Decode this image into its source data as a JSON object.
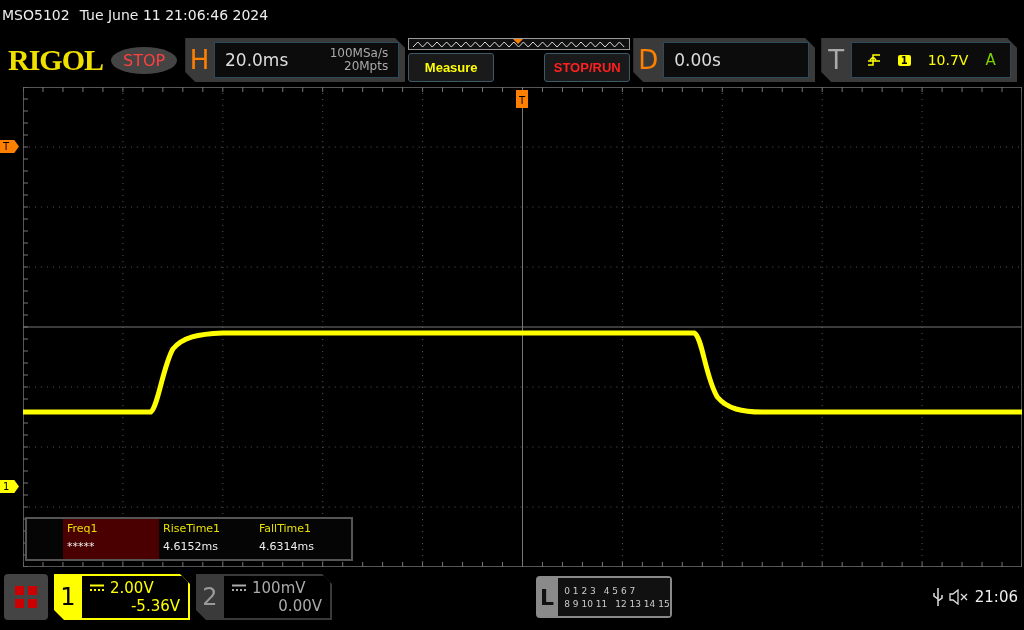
{
  "status_line": {
    "model": "MSO5102",
    "datetime": "Tue June 11 21:06:46 2024"
  },
  "toolbar": {
    "logo": "RIGOL",
    "run_state": "STOP",
    "horizontal": {
      "label": "H",
      "timebase": "20.0ms",
      "sample_rate": "100MSa/s",
      "memory_depth": "20Mpts"
    },
    "buttons": [
      {
        "label": "Measure",
        "kind": "measure"
      },
      {
        "label": "STOP/RUN",
        "kind": "run"
      }
    ],
    "delay": {
      "label": "D",
      "value": "0.00s"
    },
    "trigger": {
      "label": "T",
      "source": "1",
      "level": "10.7V",
      "mode": "A"
    }
  },
  "screen": {
    "trigger_position_marker": "T",
    "markers": [
      {
        "label": "T",
        "kind": "trigger"
      },
      {
        "label": "1",
        "kind": "channel"
      }
    ],
    "measurements": [
      {
        "name": "Freq1",
        "value": "*****",
        "selected": true
      },
      {
        "name": "RiseTime1",
        "value": "4.6152ms",
        "selected": false
      },
      {
        "name": "FallTime1",
        "value": "4.6314ms",
        "selected": false
      }
    ]
  },
  "channels": [
    {
      "number": "1",
      "scale": "2.00V",
      "offset": "-5.36V",
      "on": true
    },
    {
      "number": "2",
      "scale": "100mV",
      "offset": "0.00V",
      "on": false
    }
  ],
  "logic": {
    "label": "L",
    "rows": [
      [
        "0 1 2 3",
        "4 5 6 7"
      ],
      [
        "8 9 10 11",
        "12 13 14 15"
      ]
    ]
  },
  "clock": "21:06"
}
